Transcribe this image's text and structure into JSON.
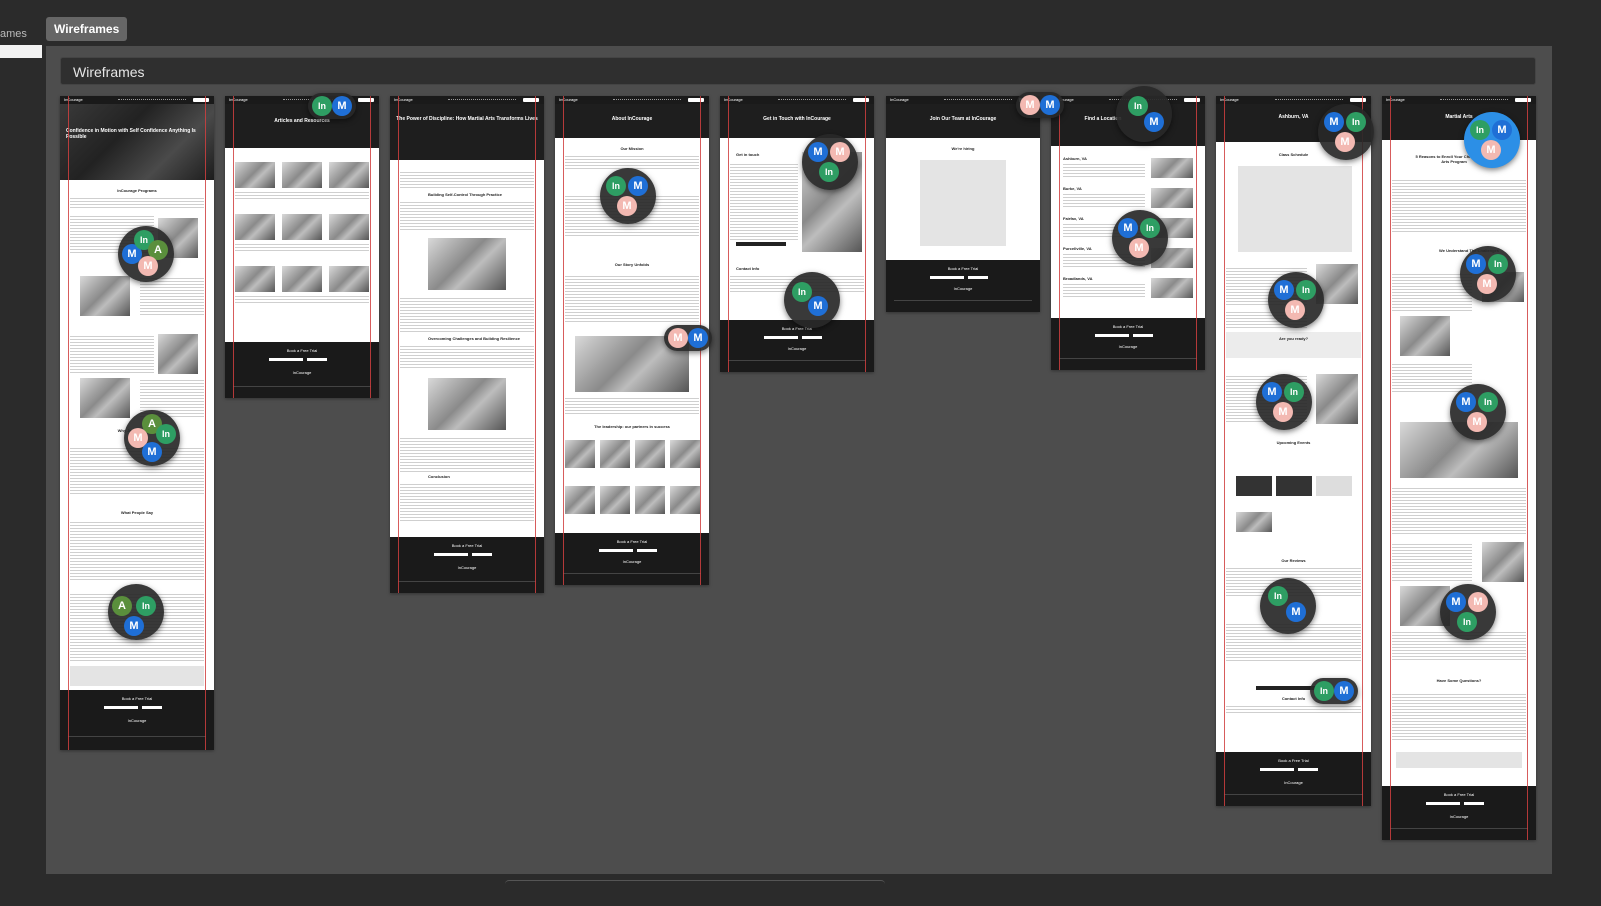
{
  "sidebar": {
    "label_fragment": "ames"
  },
  "tab": {
    "label": "Wireframes"
  },
  "section": {
    "title": "Wireframes"
  },
  "colors": {
    "background": "#2b2b2b",
    "canvas": "#4d4d4d",
    "guide": "#d04040",
    "avatar_m": "#1f6fd6",
    "avatar_in": "#2e9e63",
    "avatar_p": "#f3b9b2"
  },
  "frames": [
    {
      "logo": "InCourage",
      "title": "Confidence in Motion with Self Confidence Anything Is Possible",
      "heading1": "InCourage Programs",
      "heading2": "Why Join InCourage",
      "heading3": "What People Say",
      "footer_title": "Book a Free Trial",
      "footer_logo": "InCourage"
    },
    {
      "logo": "InCourage",
      "title": "Articles and Resources",
      "footer_title": "Book a Free Trial",
      "footer_logo": "InCourage"
    },
    {
      "logo": "InCourage",
      "title": "The Power of Discipline: How Martial Arts Transforms Lives",
      "heading1": "Building Self-Control Through Practice",
      "heading2": "Overcoming Challenges and Building Resilience",
      "heading3": "Conclusion",
      "footer_title": "Book a Free Trial",
      "footer_logo": "InCourage"
    },
    {
      "logo": "InCourage",
      "title": "About InCourage",
      "heading1": "Our Mission",
      "heading2": "Our Story Unfolds",
      "heading3": "The leadership: our partners in success",
      "footer_title": "Book a Free Trial",
      "footer_logo": "InCourage"
    },
    {
      "logo": "InCourage",
      "title": "Get in Touch with InCourage",
      "heading1": "Get in touch",
      "heading2": "Contact Info",
      "footer_title": "Book a Free Trial",
      "footer_logo": "InCourage"
    },
    {
      "logo": "InCourage",
      "title": "Join Our Team at InCourage",
      "heading1": "We're hiring",
      "footer_title": "Book a Free Trial",
      "footer_logo": "InCourage"
    },
    {
      "logo": "InCourage",
      "title": "Find a Location",
      "locations": [
        "Ashburn, VA",
        "Burke, VA",
        "Fairfax, VA",
        "Purcellville, VA",
        "Broadlands, VA"
      ],
      "footer_title": "Book a Free Trial",
      "footer_logo": "InCourage"
    },
    {
      "logo": "InCourage",
      "title": "Ashburn, VA",
      "heading1": "Class Schedule",
      "heading2": "Are you ready?",
      "heading3": "Upcoming Events",
      "heading4": "Our Reviews",
      "heading5": "Contact Info",
      "footer_title": "Book a Free Trial",
      "footer_logo": "InCourage"
    },
    {
      "logo": "InCourage",
      "title": "Martial Arts",
      "heading1": "5 Reasons to Enroll Your Child in Martial Arts Program",
      "heading2": "We Understand The Challenges",
      "heading3": "Have Some Questions?",
      "footer_title": "Book a Free Trial",
      "footer_logo": "InCourage"
    }
  ],
  "avatars": {
    "m": "M",
    "in": "In",
    "a": "A"
  }
}
